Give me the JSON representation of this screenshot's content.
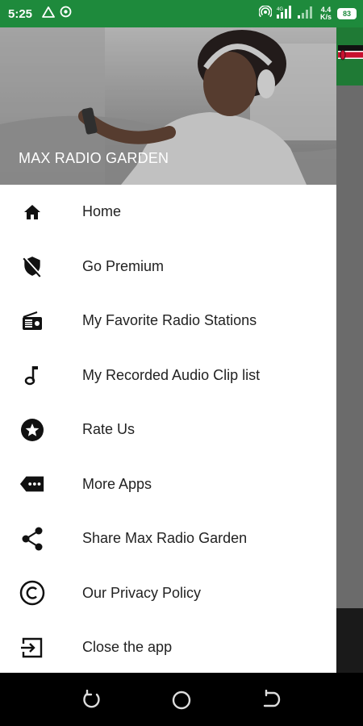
{
  "status_bar": {
    "time": "5:25",
    "net_speed_value": "4.4",
    "net_speed_unit": "K/s",
    "battery": "83",
    "left_icons": [
      "alert-triangle-icon",
      "notification-icon"
    ],
    "right_icons": [
      "hotspot-icon",
      "signal-icon",
      "signal-weak-icon"
    ]
  },
  "drawer": {
    "header_title": "MAX RADIO GARDEN",
    "items": [
      {
        "label": "Home",
        "icon": "home-icon"
      },
      {
        "label": "Go Premium",
        "icon": "shield-off-icon"
      },
      {
        "label": "My Favorite Radio Stations",
        "icon": "radio-icon"
      },
      {
        "label": "My Recorded Audio Clip list",
        "icon": "music-note-icon"
      },
      {
        "label": "Rate Us",
        "icon": "star-circle-icon"
      },
      {
        "label": "More Apps",
        "icon": "more-tag-icon"
      },
      {
        "label": "Share Max Radio Garden",
        "icon": "share-icon"
      },
      {
        "label": "Our Privacy Policy",
        "icon": "copyright-icon"
      },
      {
        "label": "Close the app",
        "icon": "exit-icon"
      }
    ]
  },
  "navigation": [
    "recents-button",
    "home-button",
    "back-button"
  ],
  "colors": {
    "status_bar": "#1e8a3c",
    "drawer_bg": "#ffffff",
    "text": "#222222",
    "nav_bar": "#000000"
  }
}
